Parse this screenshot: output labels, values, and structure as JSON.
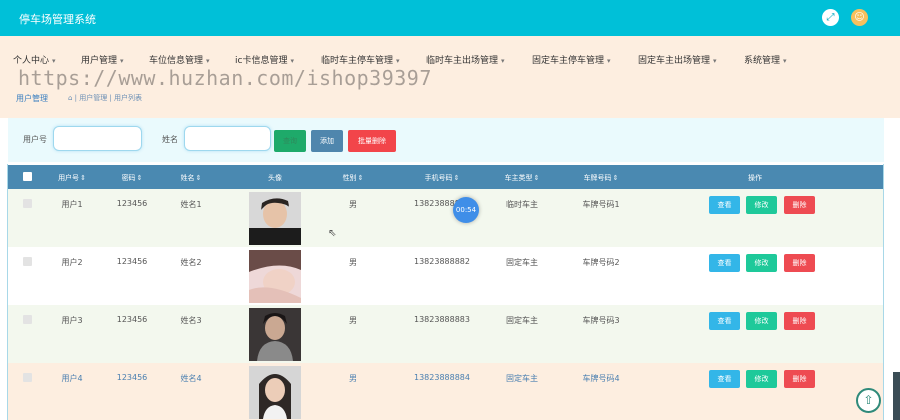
{
  "app": {
    "title": "停车场管理系统",
    "fullscreen_icon": "⤢",
    "avatar_icon": "☺"
  },
  "nav": {
    "items": [
      "个人中心",
      "用户管理",
      "车位信息管理",
      "ic卡信息管理",
      "临时车主停车管理",
      "临时车主出场管理",
      "固定车主停车管理",
      "固定车主出场管理",
      "系统管理"
    ],
    "caret": "▾"
  },
  "breadcrumb": {
    "title": "用户管理",
    "path": "⌂ | 用户管理 | 用户列表"
  },
  "watermark": "https://www.huzhan.com/ishop39397",
  "search": {
    "user_no_label": "用户号",
    "name_label": "姓名",
    "user_no_value": "",
    "name_value": "",
    "search_btn": "查询",
    "add_btn": "添加",
    "batch_delete_btn": "批量删除"
  },
  "table": {
    "headers": [
      "用户号",
      "密码",
      "姓名",
      "头像",
      "性别",
      "手机号码",
      "车主类型",
      "车牌号码",
      "操作"
    ],
    "sort_icon": "⇕",
    "rows": [
      {
        "user_no": "用户1",
        "password": "123456",
        "name": "姓名1",
        "gender": "男",
        "phone": "13823888881",
        "owner_type": "临时车主",
        "plate": "车牌号码1"
      },
      {
        "user_no": "用户2",
        "password": "123456",
        "name": "姓名2",
        "gender": "男",
        "phone": "13823888882",
        "owner_type": "固定车主",
        "plate": "车牌号码2"
      },
      {
        "user_no": "用户3",
        "password": "123456",
        "name": "姓名3",
        "gender": "男",
        "phone": "13823888883",
        "owner_type": "固定车主",
        "plate": "车牌号码3"
      },
      {
        "user_no": "用户4",
        "password": "123456",
        "name": "姓名4",
        "gender": "男",
        "phone": "13823888884",
        "owner_type": "固定车主",
        "plate": "车牌号码4"
      }
    ],
    "actions": {
      "view": "查看",
      "edit": "修改",
      "delete": "删除"
    }
  },
  "overlay": {
    "timer": "00:54",
    "cursor_icon": "⇖",
    "back_to_top_icon": "⇧"
  },
  "colors": {
    "topbar": "#00c0d8",
    "nav_bg": "#fdeee0",
    "table_header": "#4a89b1",
    "view": "#33b6e8",
    "edit": "#1ec99a",
    "delete": "#ee4b52"
  }
}
